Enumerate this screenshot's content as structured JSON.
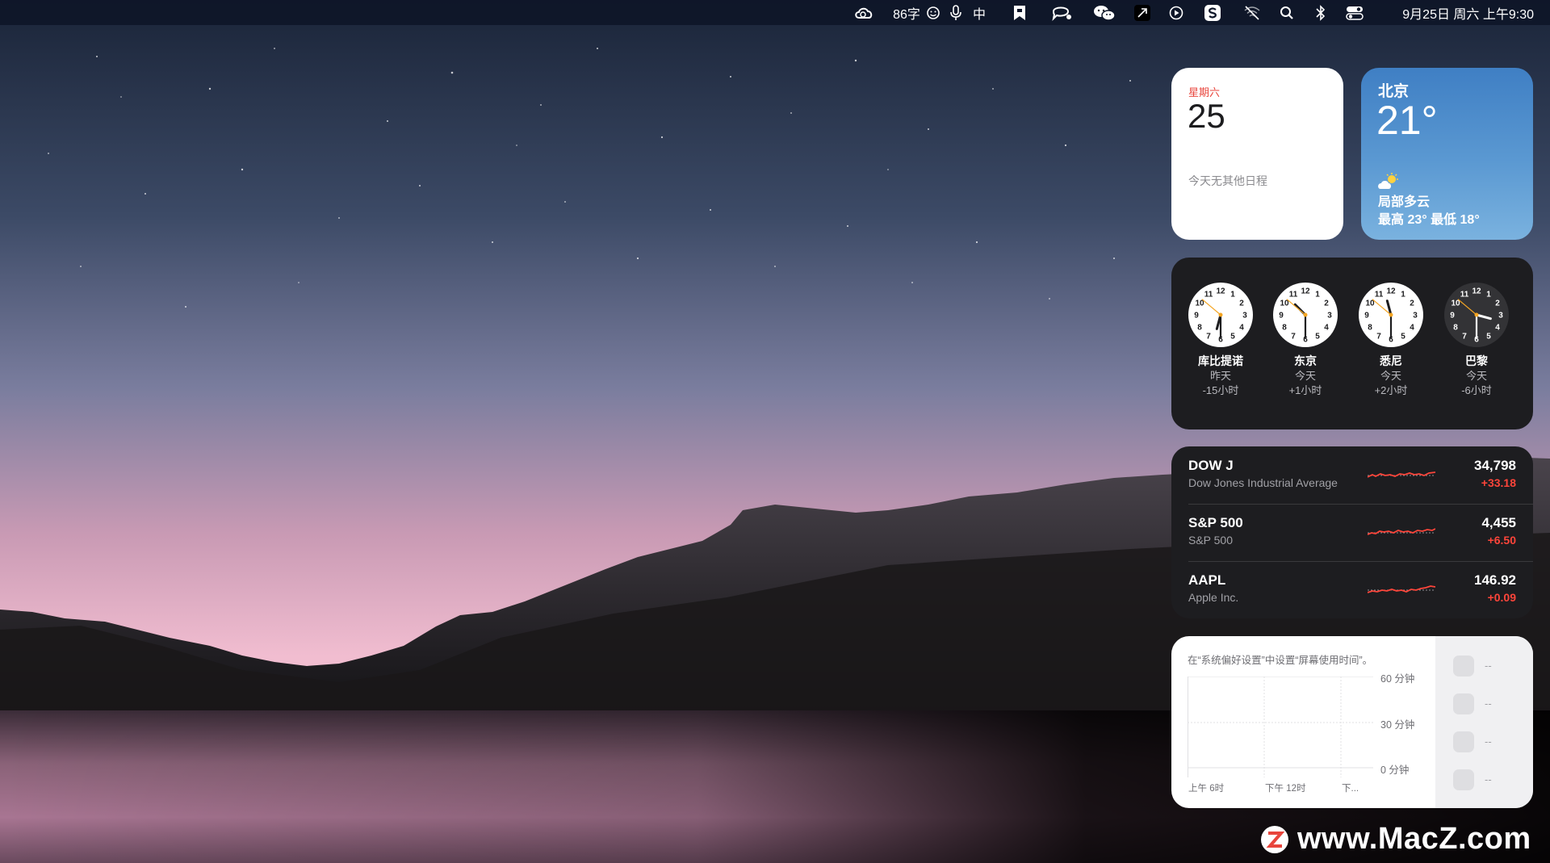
{
  "menubar": {
    "word_count": "86字",
    "input_method": "中",
    "datetime": "9月25日 周六 上午9:30",
    "icons": [
      "creative-cloud-icon",
      "emoji-icon",
      "microphone-icon",
      "input-method-icon",
      "bookmark-app-icon",
      "chat-bubble-icon",
      "wechat-icon",
      "app-tile-icon",
      "play-circle-icon",
      "s-app-icon",
      "wifi-off-icon",
      "search-icon",
      "bluetooth-icon",
      "control-center-icon"
    ]
  },
  "calendar": {
    "weekday": "星期六",
    "date": "25",
    "note": "今天无其他日程"
  },
  "weather": {
    "city": "北京",
    "temperature": "21°",
    "condition": "局部多云",
    "range": "最高 23° 最低 18°",
    "icon": "partly-cloudy-icon"
  },
  "world_clock": [
    {
      "city": "库比提诺",
      "day": "昨天",
      "offset": "-15小时",
      "time": "18:30",
      "dark": false
    },
    {
      "city": "东京",
      "day": "今天",
      "offset": "+1小时",
      "time": "10:30",
      "dark": false
    },
    {
      "city": "悉尼",
      "day": "今天",
      "offset": "+2小时",
      "time": "11:30",
      "dark": false
    },
    {
      "city": "巴黎",
      "day": "今天",
      "offset": "-6小时",
      "time": "03:30",
      "dark": true
    }
  ],
  "stocks": [
    {
      "symbol": "DOW J",
      "name": "Dow Jones Industrial Average",
      "price": "34,798",
      "change": "+33.18"
    },
    {
      "symbol": "S&P 500",
      "name": "S&P 500",
      "price": "4,455",
      "change": "+6.50"
    },
    {
      "symbol": "AAPL",
      "name": "Apple Inc.",
      "price": "146.92",
      "change": "+0.09"
    }
  ],
  "screen_time": {
    "message": "在“系统偏好设置”中设置“屏幕使用时间”。",
    "y_labels": [
      "60 分钟",
      "30 分钟",
      "0 分钟"
    ],
    "x_labels": [
      "上午 6时",
      "下午 12时",
      "下..."
    ],
    "placeholder": "--"
  },
  "watermark": {
    "text": "www.MacZ.com"
  },
  "colors": {
    "negative_accent": "#ff453a",
    "calendar_red": "#e8453c"
  }
}
